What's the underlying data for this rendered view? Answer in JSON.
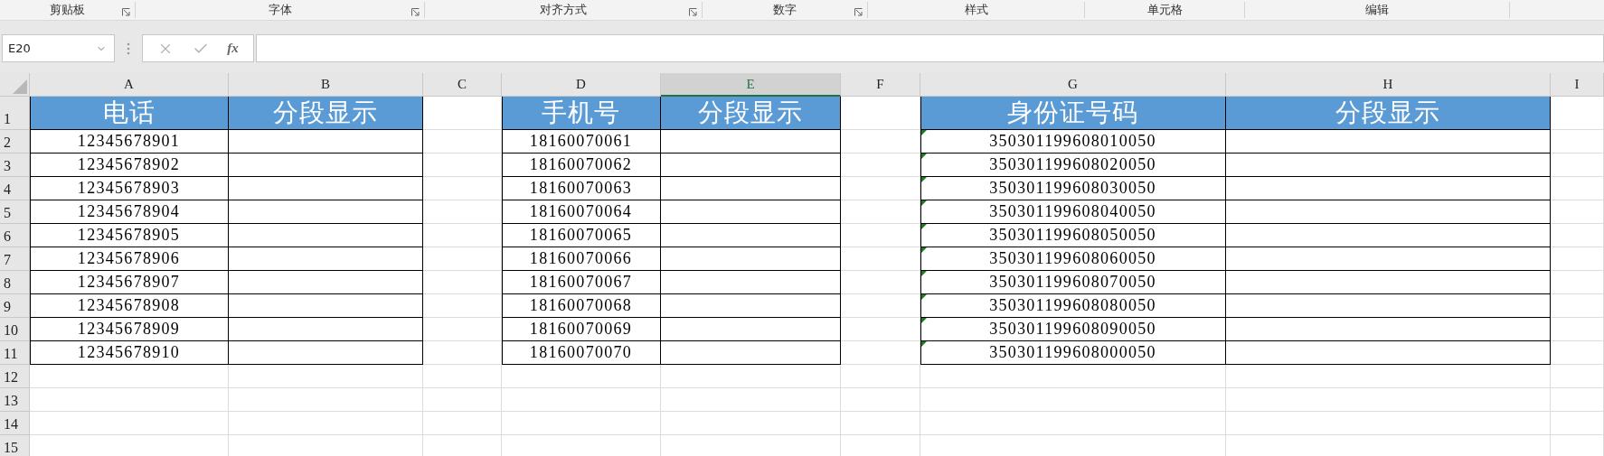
{
  "ribbon_groups": [
    {
      "label": "剪贴板",
      "launcher": true
    },
    {
      "label": "字体",
      "launcher": true
    },
    {
      "label": "对齐方式",
      "launcher": true
    },
    {
      "label": "数字",
      "launcher": true
    },
    {
      "label": "样式",
      "launcher": false
    },
    {
      "label": "单元格",
      "launcher": false
    },
    {
      "label": "编辑",
      "launcher": false
    }
  ],
  "formula_bar": {
    "name_box": "E20",
    "function_button": "fx"
  },
  "columns": [
    {
      "letter": "A",
      "selected": false
    },
    {
      "letter": "B",
      "selected": false
    },
    {
      "letter": "C",
      "selected": false
    },
    {
      "letter": "D",
      "selected": false
    },
    {
      "letter": "E",
      "selected": true
    },
    {
      "letter": "F",
      "selected": false
    },
    {
      "letter": "G",
      "selected": false
    },
    {
      "letter": "H",
      "selected": false
    },
    {
      "letter": "I",
      "selected": false
    }
  ],
  "row_numbers": [
    "1",
    "2",
    "3",
    "4",
    "5",
    "6",
    "7",
    "8",
    "9",
    "10",
    "11",
    "12",
    "13",
    "14",
    "15"
  ],
  "tables": [
    {
      "headers": [
        "电话",
        "分段显示"
      ],
      "error_flags": false,
      "values": [
        "12345678901",
        "12345678902",
        "12345678903",
        "12345678904",
        "12345678905",
        "12345678906",
        "12345678907",
        "12345678908",
        "12345678909",
        "12345678910"
      ]
    },
    {
      "headers": [
        "手机号",
        "分段显示"
      ],
      "error_flags": false,
      "values": [
        "18160070061",
        "18160070062",
        "18160070063",
        "18160070064",
        "18160070065",
        "18160070066",
        "18160070067",
        "18160070068",
        "18160070069",
        "18160070070"
      ]
    },
    {
      "headers": [
        "身份证号码",
        "分段显示"
      ],
      "error_flags": true,
      "values": [
        "350301199608010050",
        "350301199608020050",
        "350301199608030050",
        "350301199608040050",
        "350301199608050050",
        "350301199608060050",
        "350301199608070050",
        "350301199608080050",
        "350301199608090050",
        "350301199608000050"
      ]
    }
  ]
}
